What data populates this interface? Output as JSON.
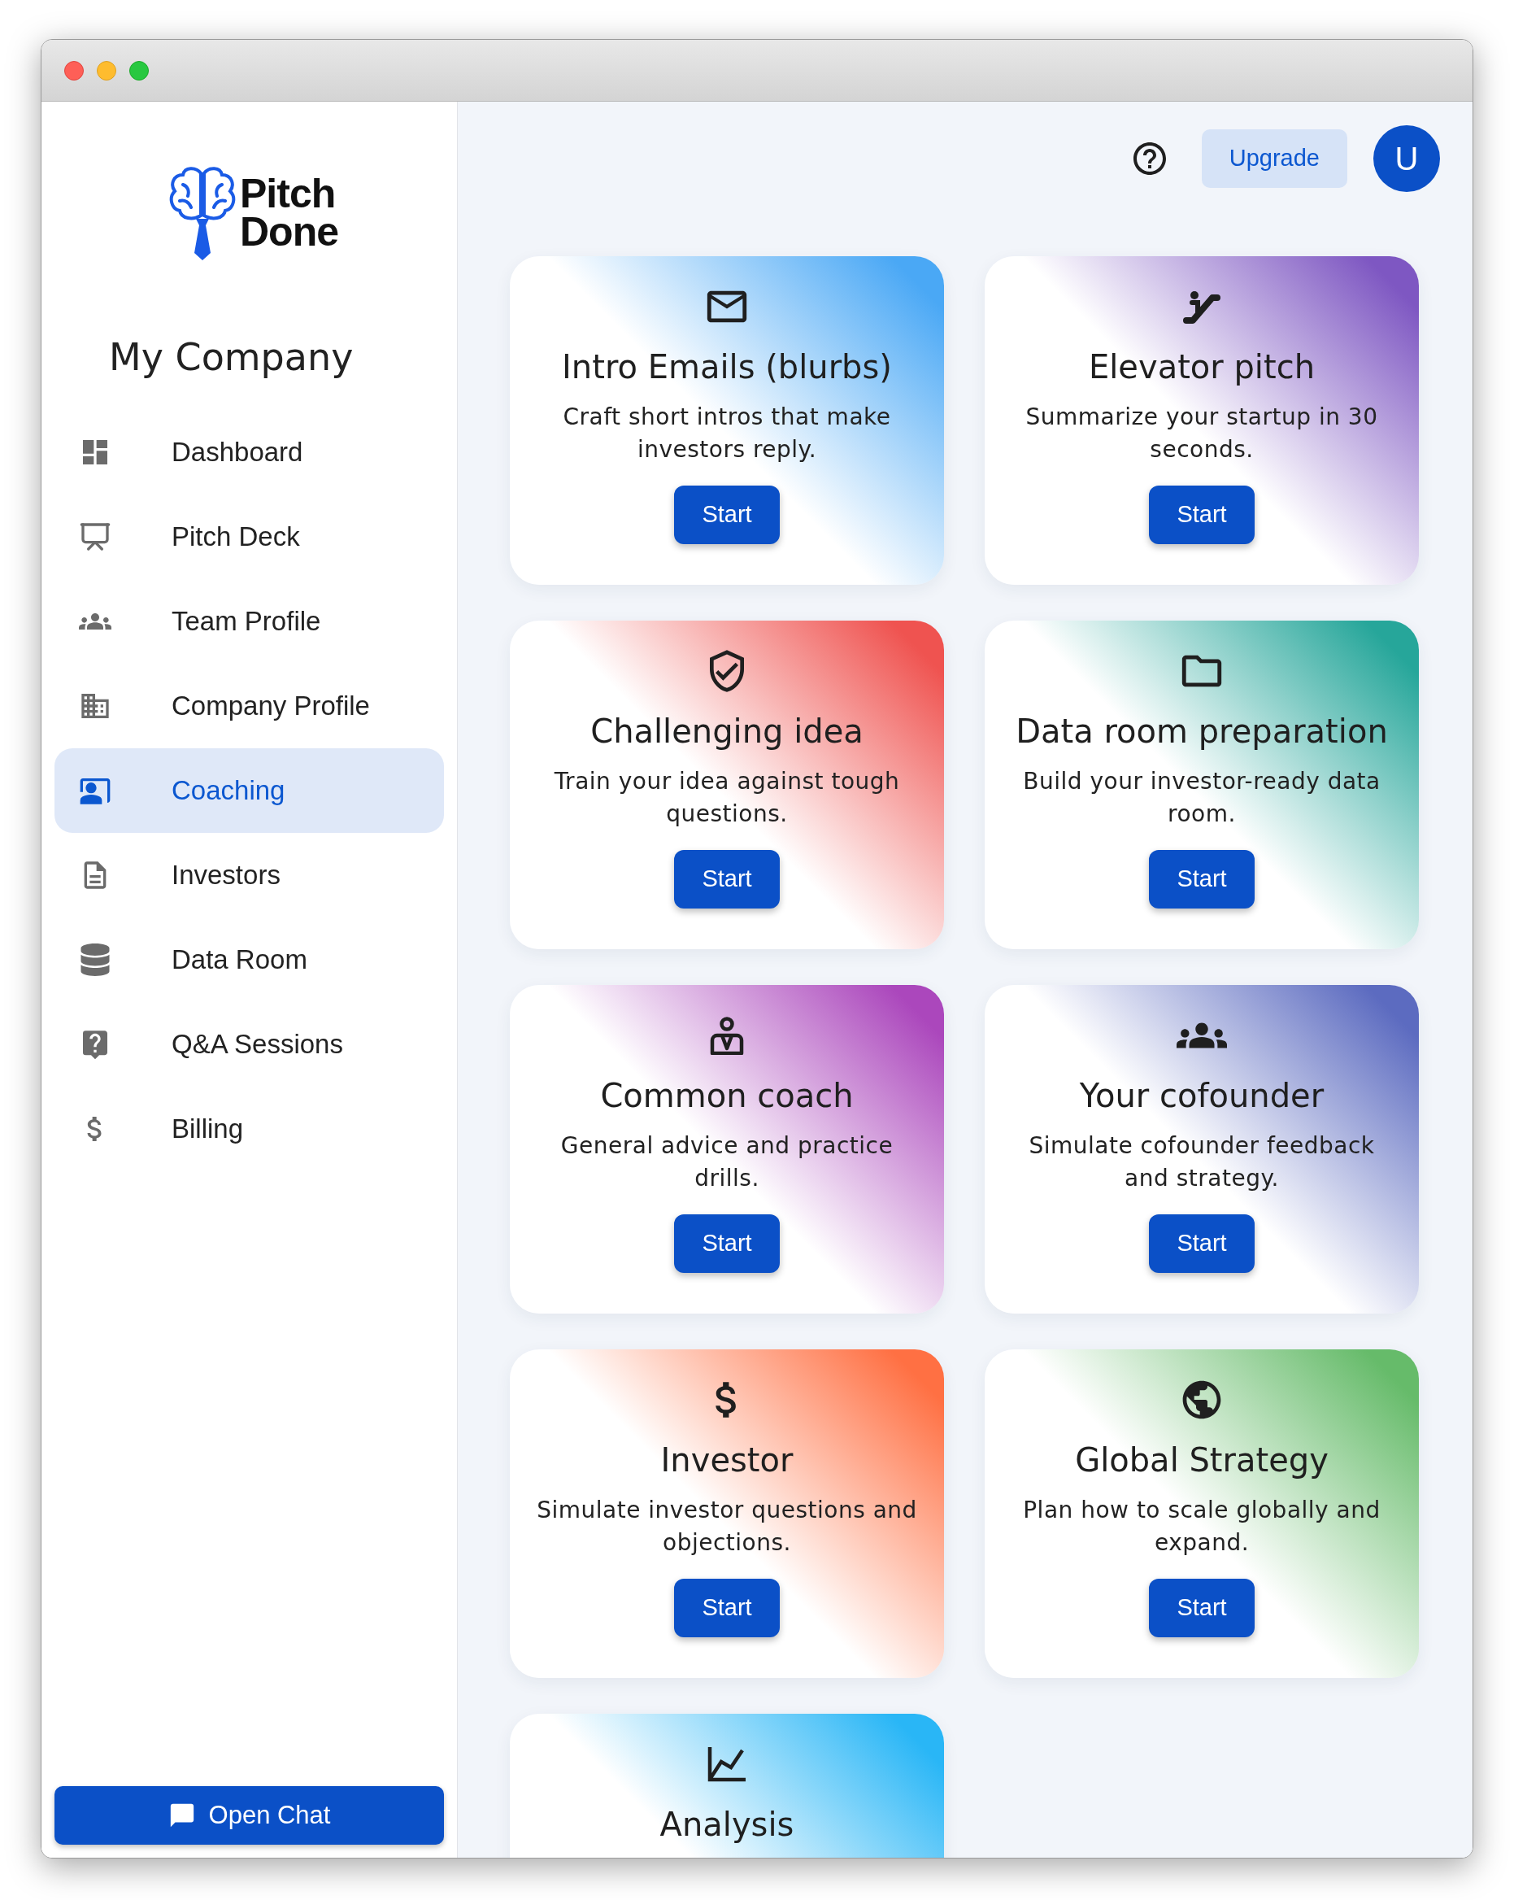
{
  "logo": {
    "lines": [
      "Pitch",
      "Done"
    ]
  },
  "company": "My Company",
  "nav": [
    {
      "label": "Dashboard",
      "selected": false
    },
    {
      "label": "Pitch Deck",
      "selected": false
    },
    {
      "label": "Team Profile",
      "selected": false
    },
    {
      "label": "Company Profile",
      "selected": false
    },
    {
      "label": "Coaching",
      "selected": true
    },
    {
      "label": "Investors",
      "selected": false
    },
    {
      "label": "Data Room",
      "selected": false
    },
    {
      "label": "Q&A Sessions",
      "selected": false
    },
    {
      "label": "Billing",
      "selected": false
    }
  ],
  "open_chat": "Open Chat",
  "header": {
    "upgrade": "Upgrade",
    "avatar": "U"
  },
  "cards": [
    {
      "title": "Intro Emails (blurbs)",
      "description": "Craft short intros that make investors reply.",
      "button": "Start",
      "color": "#4aa8f5"
    },
    {
      "title": "Elevator pitch",
      "description": "Summarize your startup in 30 seconds.",
      "button": "Start",
      "color": "#7e57c2"
    },
    {
      "title": "Challenging idea",
      "description": "Train your idea against tough questions.",
      "button": "Start",
      "color": "#ef5350"
    },
    {
      "title": "Data room preparation",
      "description": "Build your investor-ready data room.",
      "button": "Start",
      "color": "#26a69a"
    },
    {
      "title": "Common coach",
      "description": "General advice and practice drills.",
      "button": "Start",
      "color": "#ab47bc"
    },
    {
      "title": "Your cofounder",
      "description": "Simulate cofounder feedback and strategy.",
      "button": "Start",
      "color": "#5c6bc0"
    },
    {
      "title": "Investor",
      "description": "Simulate investor questions and objections.",
      "button": "Start",
      "color": "#ff7043"
    },
    {
      "title": "Global Strategy",
      "description": "Plan how to scale globally and expand.",
      "button": "Start",
      "color": "#66bb6a"
    },
    {
      "title": "Analysis",
      "color": "#29b6f6"
    }
  ]
}
